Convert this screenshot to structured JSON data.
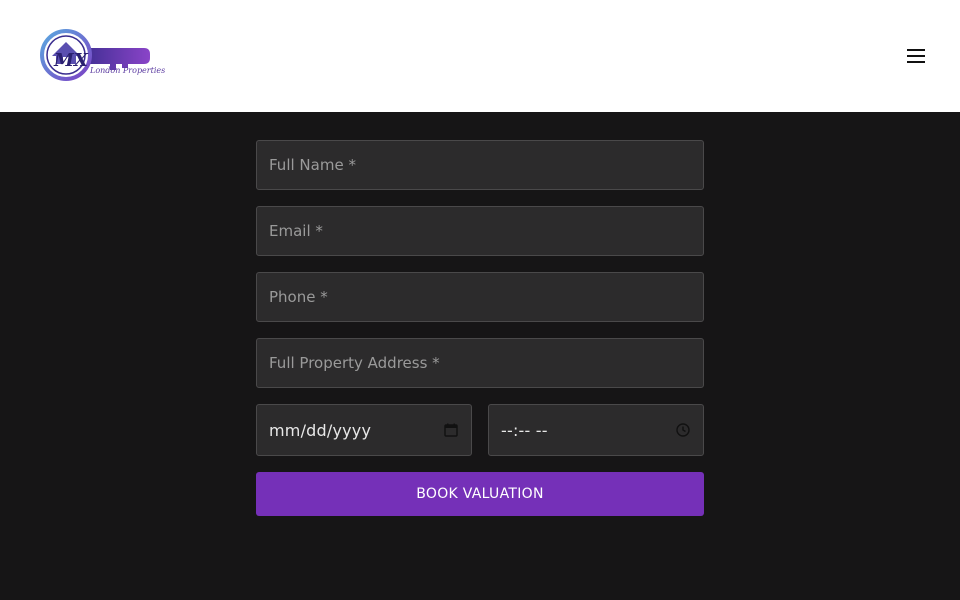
{
  "header": {
    "logo": {
      "text_main": "MX",
      "text_script": "London Properties",
      "brand_colors": [
        "#3a2d8f",
        "#7b3fc4",
        "#5aa9e0"
      ]
    },
    "menu_icon": "hamburger-menu-icon"
  },
  "form": {
    "fields": {
      "full_name": {
        "placeholder": "Full Name *",
        "value": ""
      },
      "email": {
        "placeholder": "Email *",
        "value": ""
      },
      "phone": {
        "placeholder": "Phone *",
        "value": ""
      },
      "address": {
        "placeholder": "Full Property Address *",
        "value": ""
      }
    },
    "date": {
      "value": "mm/dd/yyyy",
      "icon": "calendar-icon"
    },
    "time": {
      "value": "--:-- --",
      "icon": "clock-icon"
    },
    "submit_label": "BOOK VALUATION"
  },
  "colors": {
    "background": "#161516",
    "field_bg": "#2c2b2c",
    "accent": "#7530b8"
  }
}
